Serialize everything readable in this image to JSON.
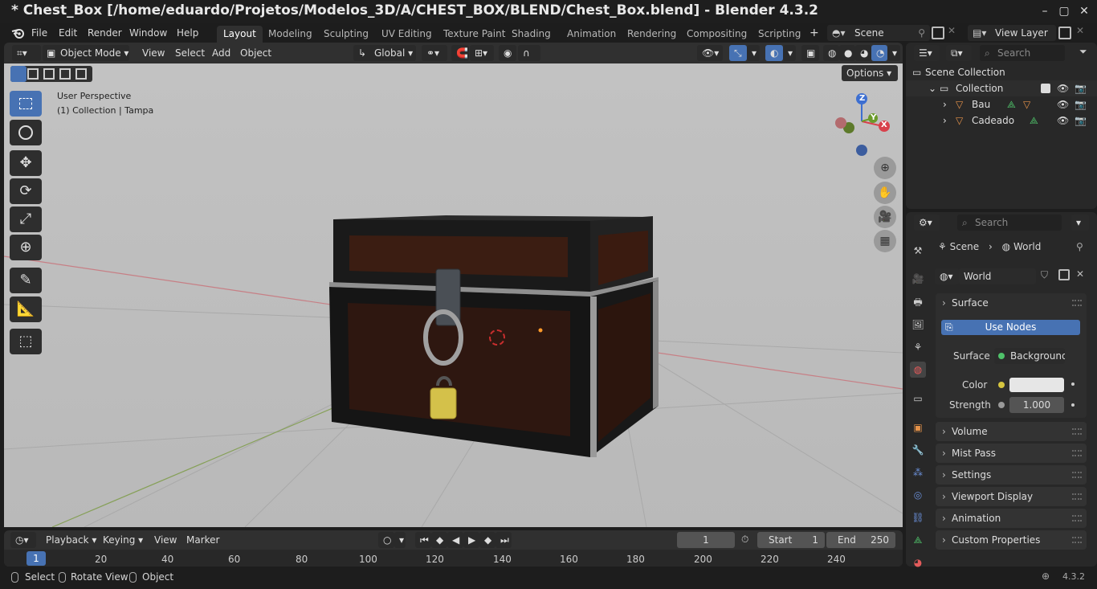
{
  "window": {
    "title": "* Chest_Box [/home/eduardo/Projetos/Modelos_3D/A/CHEST_BOX/BLEND/Chest_Box.blend] - Blender 4.3.2"
  },
  "menu": {
    "file": "File",
    "edit": "Edit",
    "render": "Render",
    "window": "Window",
    "help": "Help"
  },
  "workspaces": [
    "Layout",
    "Modeling",
    "Sculpting",
    "UV Editing",
    "Texture Paint",
    "Shading",
    "Animation",
    "Rendering",
    "Compositing",
    "Scripting"
  ],
  "scene_field": "Scene",
  "view_layer_field": "View Layer",
  "viewport_header": {
    "mode": "Object Mode",
    "view": "View",
    "select": "Select",
    "add": "Add",
    "object": "Object",
    "orientation": "Global",
    "options": "Options"
  },
  "viewport_overlay": {
    "line1": "User Perspective",
    "line2": "(1) Collection | Tampa"
  },
  "gizmo": {
    "z": "Z",
    "y": "Y",
    "x": "X"
  },
  "outliner": {
    "search_placeholder": "Search",
    "scene_collection": "Scene Collection",
    "collection": "Collection",
    "objects": [
      "Bau",
      "Cadeado"
    ]
  },
  "properties": {
    "search_placeholder": "Search",
    "breadcrumb_scene": "Scene",
    "breadcrumb_world": "World",
    "world_name": "World",
    "surface_panel": "Surface",
    "use_nodes": "Use Nodes",
    "surface_label": "Surface",
    "surface_value": "Background",
    "color_label": "Color",
    "color_value": "#e6e6e6",
    "strength_label": "Strength",
    "strength_value": "1.000",
    "panels": [
      "Volume",
      "Mist Pass",
      "Settings",
      "Viewport Display",
      "Animation",
      "Custom Properties"
    ]
  },
  "timeline": {
    "playback": "Playback",
    "keying": "Keying",
    "view": "View",
    "marker": "Marker",
    "current_frame": "1",
    "start_label": "Start",
    "start_value": "1",
    "end_label": "End",
    "end_value": "250",
    "ruler": [
      "20",
      "40",
      "60",
      "80",
      "100",
      "120",
      "140",
      "160",
      "180",
      "200",
      "220",
      "240"
    ],
    "cursor": "1"
  },
  "statusbar": {
    "select": "Select",
    "rotate": "Rotate View",
    "object": "Object",
    "version": "4.3.2"
  }
}
